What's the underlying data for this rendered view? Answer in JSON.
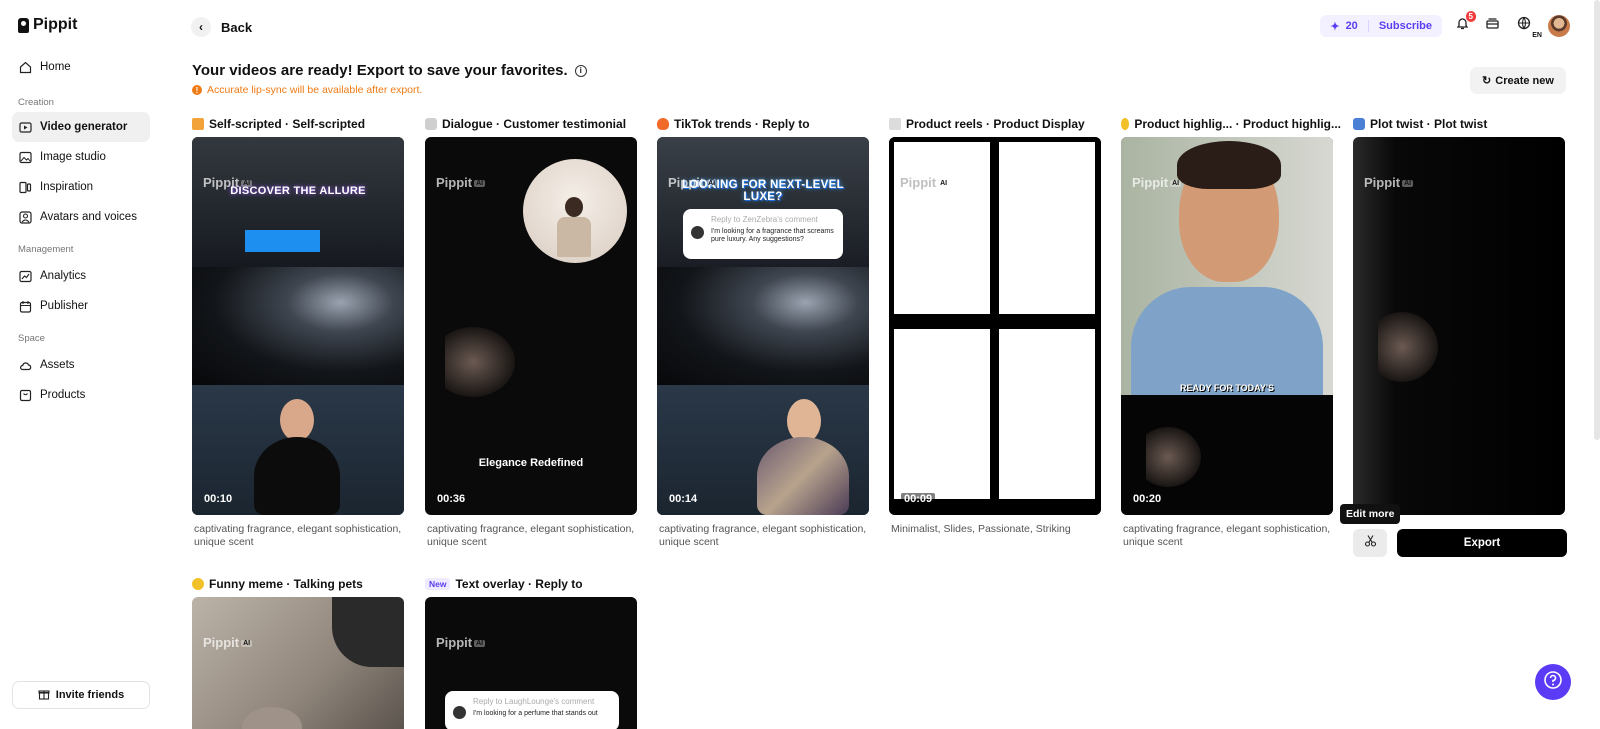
{
  "app": {
    "name": "Pippit"
  },
  "sidebar": {
    "home": "Home",
    "sections": {
      "creation": "Creation",
      "management": "Management",
      "space": "Space"
    },
    "items": [
      {
        "label": "Home",
        "icon": "home-icon"
      },
      {
        "label": "Video generator",
        "icon": "video-icon",
        "active": true
      },
      {
        "label": "Image studio",
        "icon": "image-icon"
      },
      {
        "label": "Inspiration",
        "icon": "inspiration-icon"
      },
      {
        "label": "Avatars and voices",
        "icon": "avatar-icon"
      },
      {
        "label": "Analytics",
        "icon": "analytics-icon"
      },
      {
        "label": "Publisher",
        "icon": "calendar-icon"
      },
      {
        "label": "Assets",
        "icon": "cloud-icon"
      },
      {
        "label": "Products",
        "icon": "box-icon"
      }
    ],
    "invite": "Invite friends"
  },
  "header": {
    "back": "Back",
    "credits": "20",
    "subscribe": "Subscribe",
    "notifications": "5",
    "language": "EN"
  },
  "main": {
    "title": "Your videos are ready! Export to save your favorites.",
    "warning": "Accurate lip-sync will be available after export.",
    "create_new": "Create new",
    "watermark": "Pippit",
    "watermark_ai": "AI",
    "cards": [
      {
        "title": "Self-scripted · Self-scripted",
        "duration": "00:10",
        "tags": "captivating fragrance, elegant sophistication, unique scent",
        "overlay": "DISCOVER THE ALLURE"
      },
      {
        "title": "Dialogue · Customer testimonial",
        "duration": "00:36",
        "tags": "captivating fragrance, elegant sophistication, unique scent",
        "overlay": "Elegance Redefined"
      },
      {
        "title": "TikTok trends · Reply to",
        "duration": "00:14",
        "tags": "captivating fragrance, elegant sophistication, unique scent",
        "overlay": "LOOKING FOR NEXT-LEVEL LUXE?",
        "bubble_head": "Reply to ZenZebra's comment",
        "bubble_text": "I'm looking for a fragrance that screams pure luxury. Any suggestions?"
      },
      {
        "title": "Product reels · Product Display",
        "duration": "00:09",
        "tags": "Minimalist, Slides, Passionate, Striking"
      },
      {
        "title": "Product highlig... · Product highlig...",
        "duration": "00:20",
        "tags": "captivating fragrance, elegant sophistication, unique scent",
        "overlay": "READY FOR TODAY'S"
      },
      {
        "title": "Plot twist · Plot twist",
        "duration": "",
        "tags": ""
      },
      {
        "title": "Funny meme · Talking pets",
        "duration": "",
        "tags": ""
      },
      {
        "title": "Text overlay · Reply to",
        "badge": "New",
        "duration": "",
        "tags": "",
        "bubble_head": "Reply to LaughLounge's comment",
        "bubble_text": "I'm looking for a perfume that stands out"
      }
    ],
    "edit_more": "Edit more",
    "export": "Export"
  },
  "colors": {
    "accent": "#5b3bf5",
    "warning": "#f07b15",
    "badge": "#f23c3c"
  }
}
